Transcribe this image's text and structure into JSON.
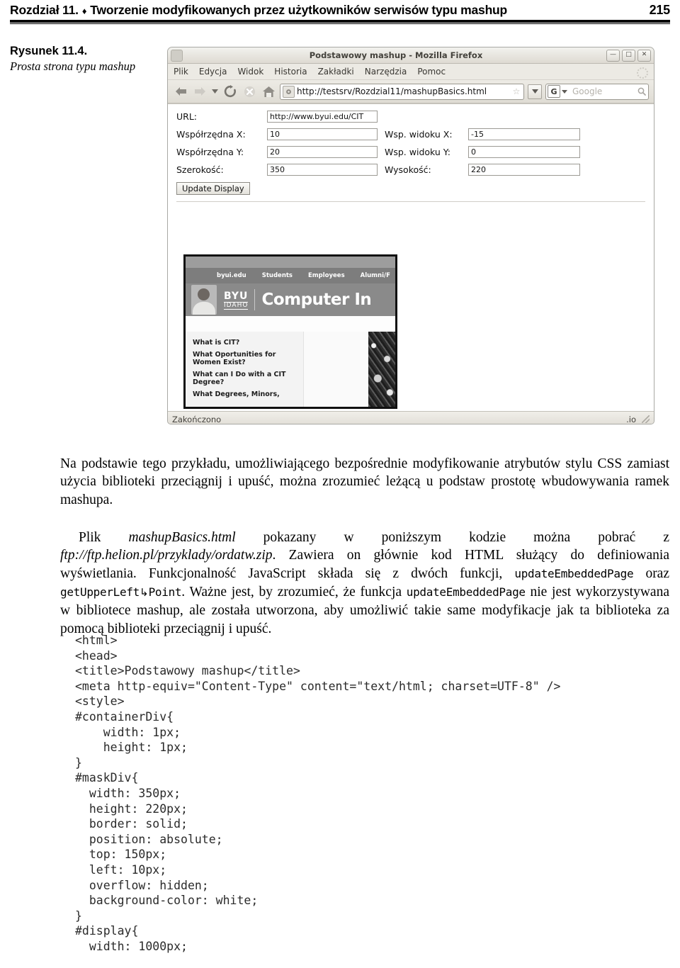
{
  "running_head": {
    "chapter": "Rozdział 11.",
    "diamond": "♦",
    "title": "Tworzenie modyfikowanych przez użytkowników serwisów typu mashup",
    "page_number": "215"
  },
  "figure": {
    "number": "Rysunek 11.4.",
    "title": "Prosta strona typu mashup"
  },
  "browser": {
    "window_title": "Podstawowy mashup - Mozilla Firefox",
    "window_buttons": {
      "minimize": "—",
      "maximize": "□",
      "close": "✕"
    },
    "menu": [
      "Plik",
      "Edycja",
      "Widok",
      "Historia",
      "Zakładki",
      "Narzędzia",
      "Pomoc"
    ],
    "toolbar_icons": [
      "back-arrow-icon",
      "forward-arrow-icon",
      "history-dropdown-icon",
      "reload-icon",
      "stop-icon",
      "home-icon"
    ],
    "url": "http://testsrv/Rozdzial11/mashupBasics.html",
    "search_engine": "G",
    "search_placeholder": "Google",
    "status_text": "Zakończono",
    "status_right": ".io"
  },
  "page_form": {
    "fields": [
      {
        "label": "URL:",
        "value": "http://www.byui.edu/CIT"
      },
      {
        "label": "Współrzędna X:",
        "value": "10"
      },
      {
        "label": "Wsp. widoku X:",
        "value": "-15"
      },
      {
        "label": "Współrzędna Y:",
        "value": "20"
      },
      {
        "label": "Wsp. widoku Y:",
        "value": "0"
      },
      {
        "label": "Szerokość:",
        "value": "350"
      },
      {
        "label": "Wysokość:",
        "value": "220"
      }
    ],
    "update_button": "Update Display"
  },
  "embedded_page": {
    "nav": [
      "byui.edu",
      "Students",
      "Employees",
      "Alumni/F"
    ],
    "brand_top": "BYU",
    "brand_bottom": "IDAHO",
    "heading": "Computer In",
    "links": [
      "What is CIT?",
      "What Oportunities for Women Exist?",
      "What can I Do with a CIT Degree?",
      "What Degrees, Minors,"
    ]
  },
  "paragraphs": {
    "p1": "Na podstawie tego przykładu, umożliwiającego bezpośrednie modyfikowanie atrybutów stylu CSS zamiast użycia biblioteki przeciągnij i upuść, można zrozumieć leżącą u podstaw prostotę wbudowywania ramek mashupa.",
    "p2_part1": "Plik ",
    "p2_file": "mashupBasics.html",
    "p2_part2": " pokazany w poniższym kodzie można pobrać z ",
    "p2_ftp": "ftp://ftp.helion.pl/przyklady/ordatw.zip",
    "p2_part3": ". Zawiera on głównie kod HTML służący do definiowania wyświetlania. Funkcjonalność JavaScript składa się z dwóch funkcji, ",
    "p2_code1": "updateEmbeddedPage",
    "p2_part4": " oraz ",
    "p2_code2": "getUpperLeft",
    "p2_wrap": "↳",
    "p2_code3": "Point",
    "p2_part5": ". Ważne jest, by zrozumieć, że funkcja ",
    "p2_code4": "updateEmbeddedPage",
    "p2_part6": " nie jest wykorzystywana w bibliotece mashup, ale została utworzona, aby umożliwić takie same modyfikacje jak ta biblioteka za pomocą biblioteki przeciągnij i upuść."
  },
  "code_listing": [
    "<html>",
    "<head>",
    "<title>Podstawowy mashup</title>",
    "<meta http-equiv=\"Content-Type\" content=\"text/html; charset=UTF-8\" />",
    "<style>",
    "#containerDiv{",
    "    width: 1px;",
    "    height: 1px;",
    "}",
    "#maskDiv{",
    "  width: 350px;",
    "  height: 220px;",
    "  border: solid;",
    "  position: absolute;",
    "  top: 150px;",
    "  left: 10px;",
    "  overflow: hidden;",
    "  background-color: white;",
    "}",
    "#display{",
    "  width: 1000px;"
  ]
}
